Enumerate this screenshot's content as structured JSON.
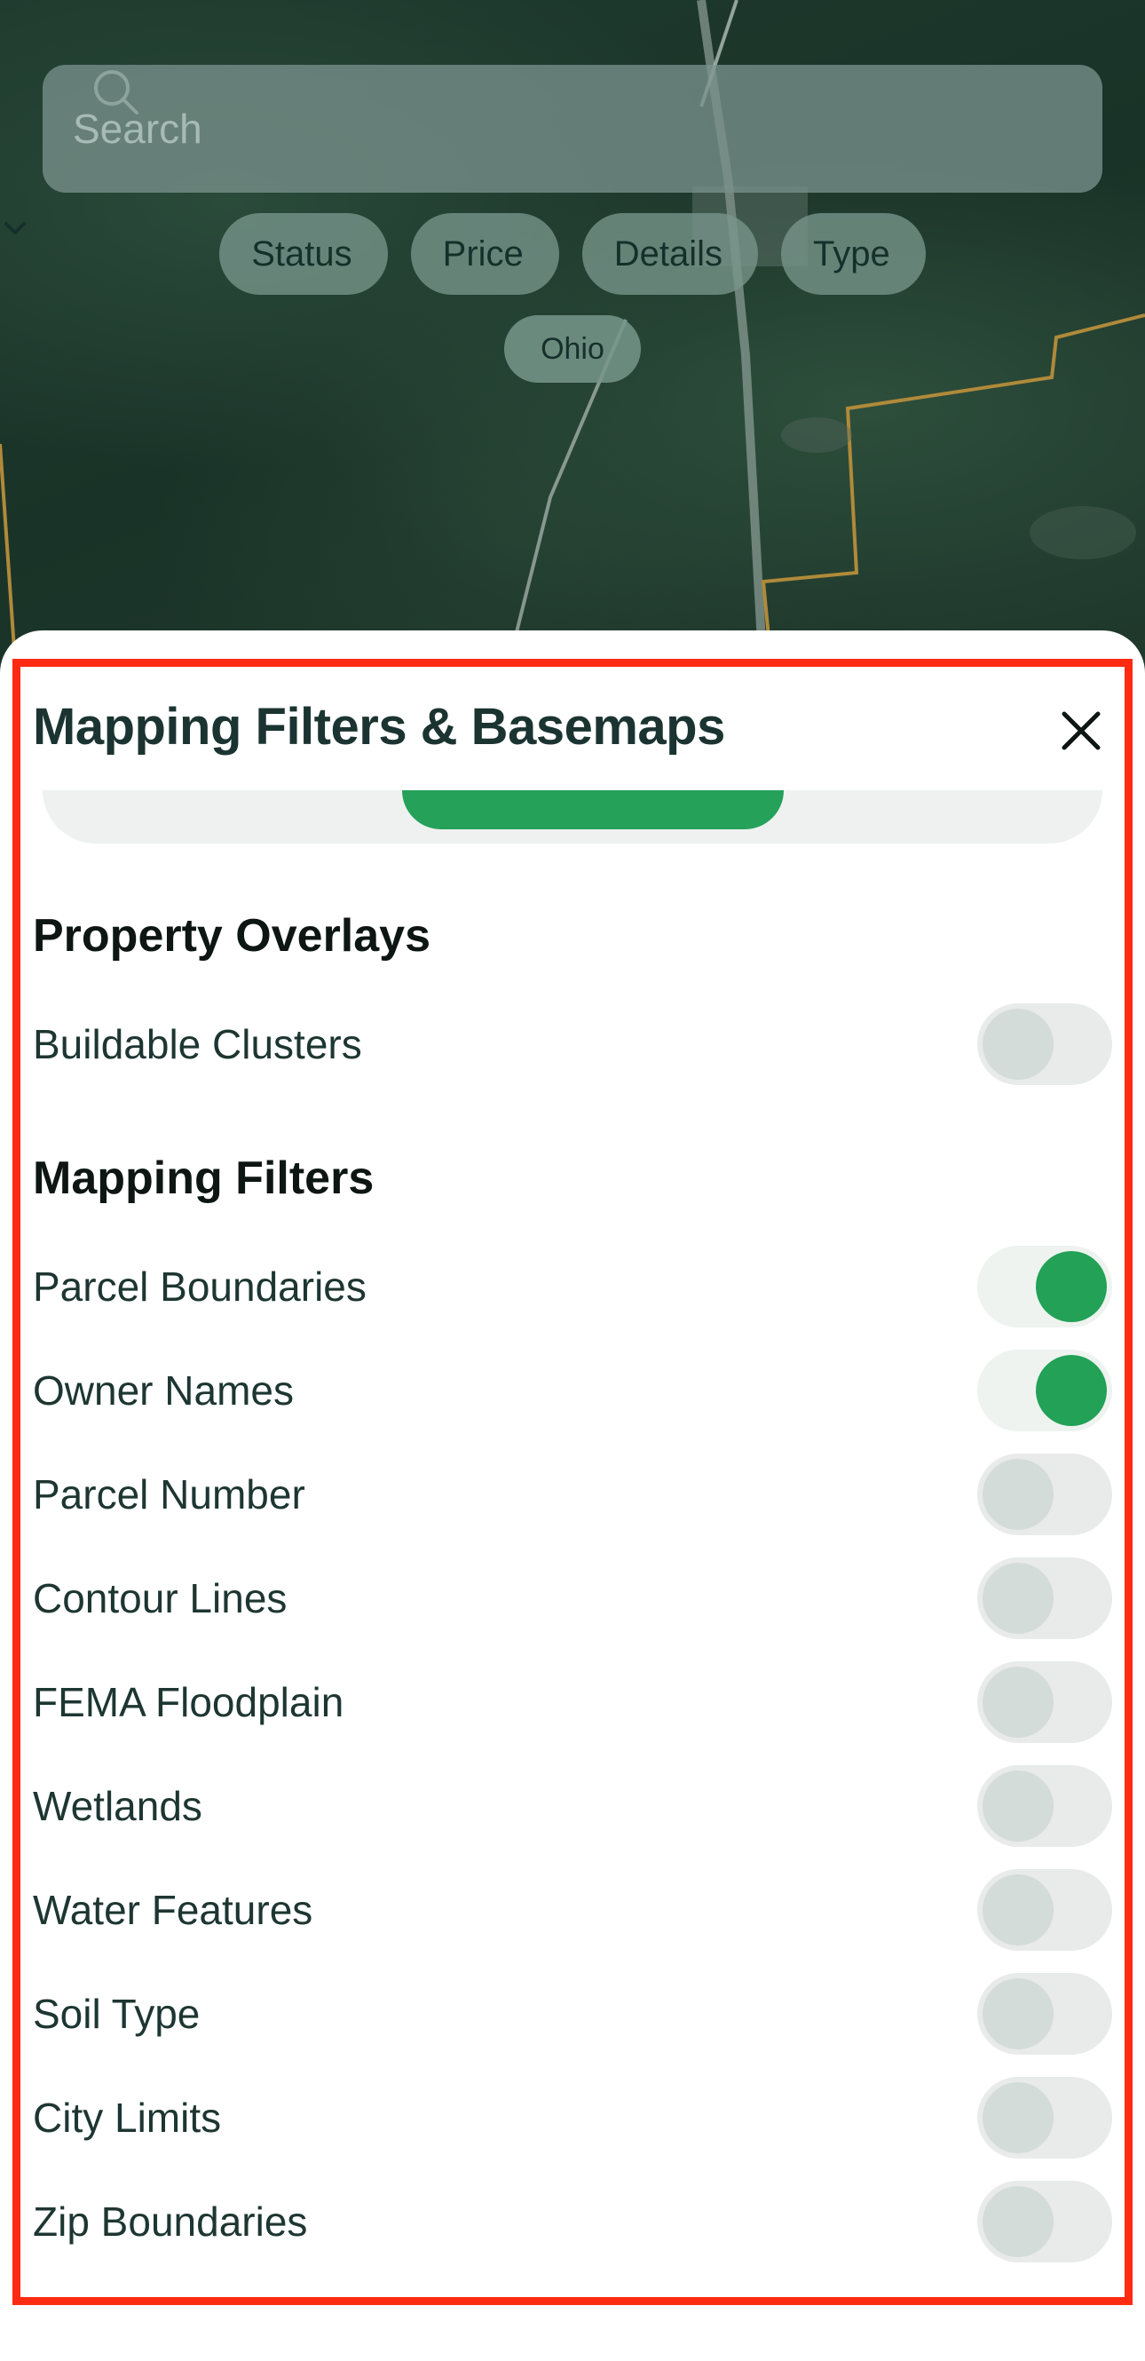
{
  "search": {
    "placeholder": "Search"
  },
  "filter_chips": [
    {
      "label": "Status"
    },
    {
      "label": "Price"
    },
    {
      "label": "Details"
    },
    {
      "label": "Type"
    }
  ],
  "region_chip": {
    "label": "Ohio"
  },
  "sheet": {
    "title": "Mapping Filters & Basemaps",
    "property_overlays": {
      "heading": "Property Overlays",
      "items": [
        {
          "label": "Buildable Clusters",
          "enabled": false
        }
      ]
    },
    "mapping_filters": {
      "heading": "Mapping Filters",
      "items": [
        {
          "label": "Parcel Boundaries",
          "enabled": true
        },
        {
          "label": "Owner Names",
          "enabled": true
        },
        {
          "label": "Parcel Number",
          "enabled": false
        },
        {
          "label": "Contour Lines",
          "enabled": false
        },
        {
          "label": "FEMA Floodplain",
          "enabled": false
        },
        {
          "label": "Wetlands",
          "enabled": false
        },
        {
          "label": "Water Features",
          "enabled": false
        },
        {
          "label": "Soil Type",
          "enabled": false
        },
        {
          "label": "City Limits",
          "enabled": false
        },
        {
          "label": "Zip Boundaries",
          "enabled": false
        }
      ]
    }
  },
  "colors": {
    "accent_green": "#22a157",
    "highlight_border": "#ff2a12",
    "parcel_line": "#b08a3a"
  },
  "icons": [
    "search-icon",
    "chevron-down-icon",
    "close-icon"
  ]
}
